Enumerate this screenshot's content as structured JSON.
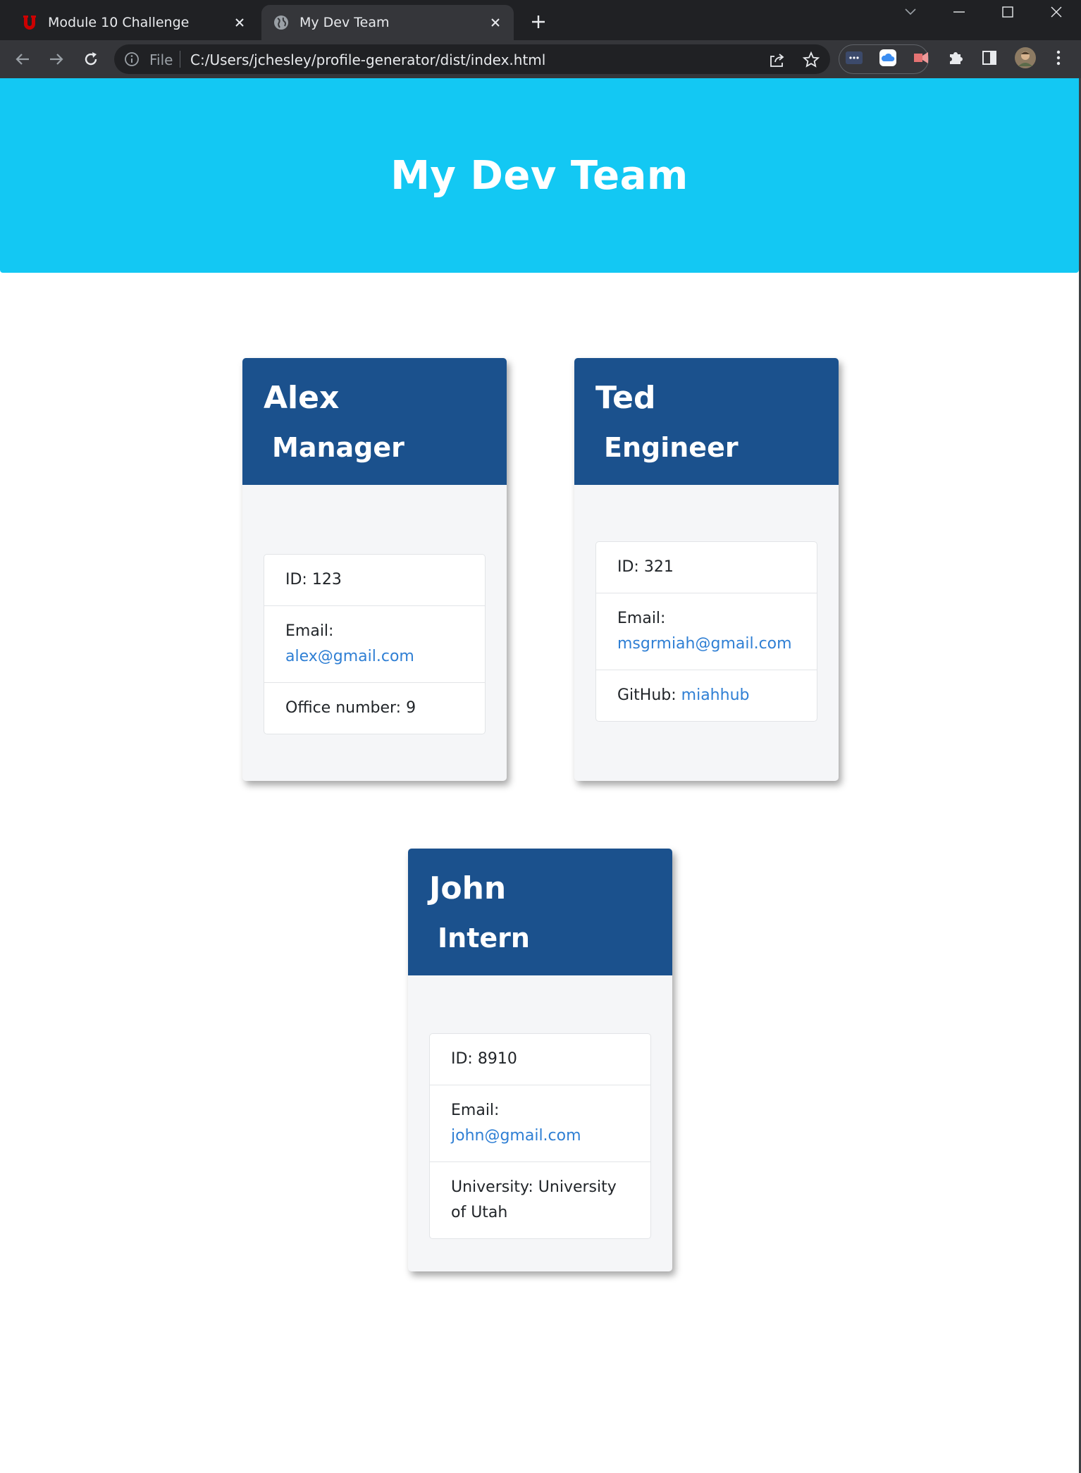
{
  "browser": {
    "tabs": [
      {
        "title": "Module 10 Challenge",
        "active": false,
        "favicon": "u-of-utah-icon"
      },
      {
        "title": "My Dev Team",
        "active": true,
        "favicon": "globe-icon"
      }
    ],
    "address": {
      "scheme": "File",
      "url": "C:/Users/jchesley/profile-generator/dist/index.html"
    }
  },
  "page": {
    "title": "My Dev Team",
    "colors": {
      "banner": "#13c8f3",
      "card_header": "#1b518d",
      "link": "#2f7fd4"
    }
  },
  "team": [
    {
      "name": "Alex",
      "role": "Manager",
      "id_label": "ID: ",
      "id": "123",
      "email_label": "Email: ",
      "email": "alex@gmail.com",
      "extra_label": "Office number: ",
      "extra": "9"
    },
    {
      "name": "Ted",
      "role": "Engineer",
      "id_label": "ID: ",
      "id": "321",
      "email_label": "Email: ",
      "email": "msgrmiah@gmail.com",
      "extra_label": "GitHub: ",
      "extra": "miahhub"
    },
    {
      "name": "John",
      "role": "Intern",
      "id_label": "ID: ",
      "id": "8910",
      "email_label": "Email: ",
      "email": "john@gmail.com",
      "extra_label": "University: ",
      "extra": "University of Utah"
    }
  ]
}
